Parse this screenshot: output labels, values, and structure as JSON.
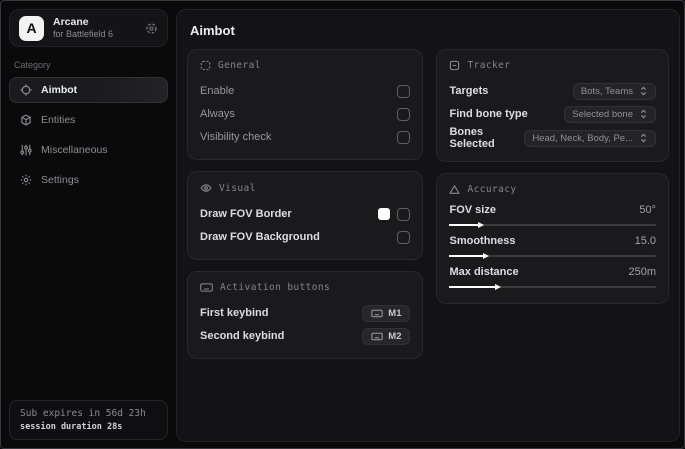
{
  "app": {
    "logo_letter": "A",
    "name": "Arcane",
    "subtitle": "for Battlefield 6"
  },
  "sidebar": {
    "category_label": "Category",
    "items": [
      {
        "label": "Aimbot",
        "icon": "crosshair-icon",
        "active": true
      },
      {
        "label": "Entities",
        "icon": "entities-cube-icon",
        "active": false
      },
      {
        "label": "Miscellaneous",
        "icon": "sliders-icon",
        "active": false
      },
      {
        "label": "Settings",
        "icon": "gear-icon",
        "active": false
      }
    ],
    "footer": {
      "line1": "Sub expires in 56d 23h",
      "line2": "session duration 28s"
    }
  },
  "main": {
    "title": "Aimbot",
    "general": {
      "title": "General",
      "rows": [
        {
          "label": "Enable",
          "checked": false
        },
        {
          "label": "Always",
          "checked": false
        },
        {
          "label": "Visibility check",
          "checked": false
        }
      ]
    },
    "visual": {
      "title": "Visual",
      "rows": [
        {
          "label": "Draw FOV Border",
          "checked": false,
          "swatch_color": "#ffffff"
        },
        {
          "label": "Draw FOV Background",
          "checked": false
        }
      ]
    },
    "activation": {
      "title": "Activation buttons",
      "rows": [
        {
          "label": "First keybind",
          "key": "M1"
        },
        {
          "label": "Second keybind",
          "key": "M2"
        }
      ]
    },
    "tracker": {
      "title": "Tracker",
      "rows": [
        {
          "label": "Targets",
          "value": "Bots, Teams"
        },
        {
          "label": "Find bone type",
          "value": "Selected bone"
        },
        {
          "label": "Bones Selected",
          "value": "Head, Neck, Body, Pe..."
        }
      ]
    },
    "accuracy": {
      "title": "Accuracy",
      "rows": [
        {
          "label": "FOV size",
          "value": "50°",
          "fill": "14%"
        },
        {
          "label": "Smoothness",
          "value": "15.0",
          "fill": "16%"
        },
        {
          "label": "Max distance",
          "value": "250m",
          "fill": "22%"
        }
      ]
    }
  },
  "colors": {
    "background": "#0a0a0b",
    "panel": "#131316",
    "card": "#1a1a1d",
    "accent": "#ffffff"
  }
}
